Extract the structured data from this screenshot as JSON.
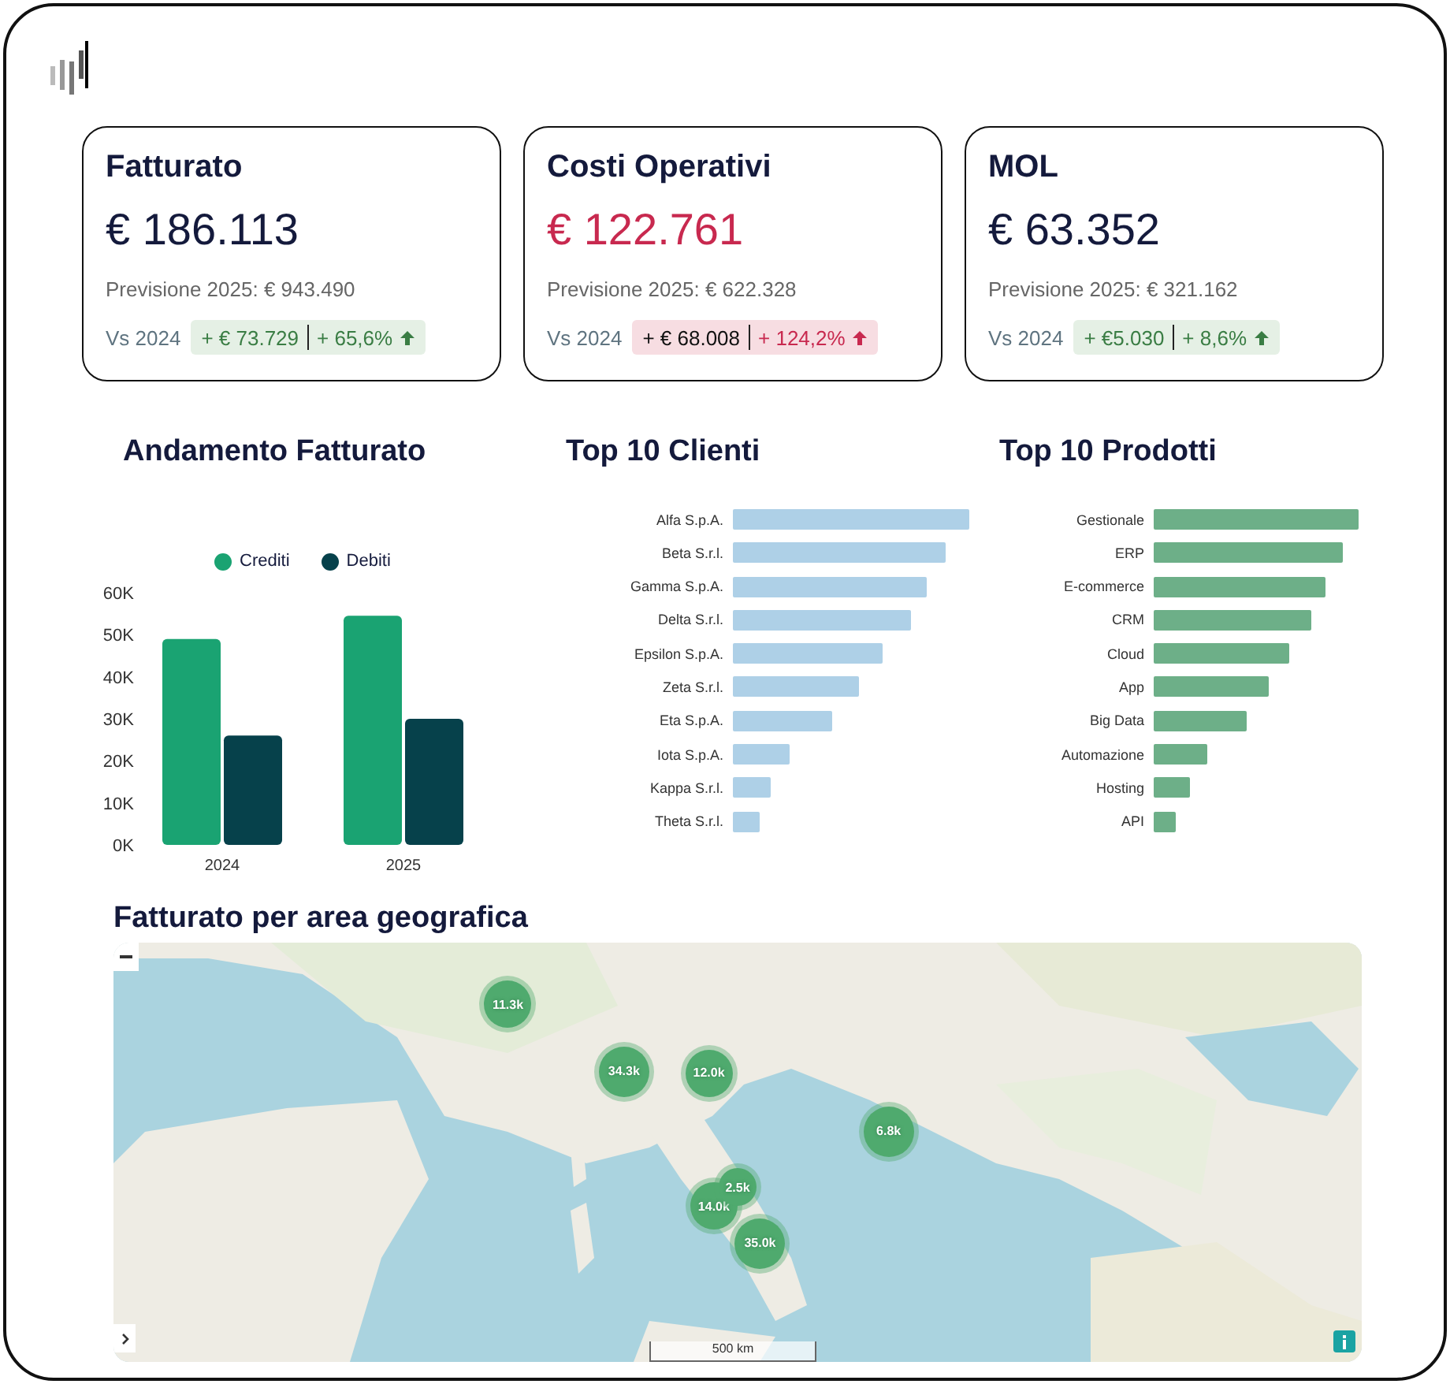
{
  "kpis": [
    {
      "title": "Fatturato",
      "value": "€ 186.113",
      "unfavorable": false,
      "forecast": "Previsione 2025: € 943.490",
      "compare_label": "Vs 2024",
      "delta_abs": "+ € 73.729",
      "delta_pct": "+ 65,6%"
    },
    {
      "title": "Costi Operativi",
      "value": "€ 122.761",
      "unfavorable": true,
      "forecast": "Previsione 2025: € 622.328",
      "compare_label": "Vs 2024",
      "delta_abs": "+ € 68.008",
      "delta_pct": "+ 124,2%"
    },
    {
      "title": "MOL",
      "value": "€ 63.352",
      "unfavorable": false,
      "forecast": "Previsione 2025: € 321.162",
      "compare_label": "Vs 2024",
      "delta_abs": "+ €5.030",
      "delta_pct": "+ 8,6%"
    }
  ],
  "trend_chart": {
    "title": "Andamento Fatturato",
    "chart_data": {
      "type": "bar",
      "categories": [
        "2024",
        "2025"
      ],
      "series": [
        {
          "name": "Crediti",
          "color": "#1aa372",
          "values": [
            49000,
            54500
          ]
        },
        {
          "name": "Debiti",
          "color": "#06414b",
          "values": [
            26000,
            30000
          ]
        }
      ],
      "ylim": [
        0,
        60000
      ],
      "yticks": [
        {
          "value": 0,
          "label": "0K"
        },
        {
          "value": 10000,
          "label": "10K"
        },
        {
          "value": 20000,
          "label": "20K"
        },
        {
          "value": 30000,
          "label": "30K"
        },
        {
          "value": 40000,
          "label": "40K"
        },
        {
          "value": 50000,
          "label": "50K"
        },
        {
          "value": 60000,
          "label": "60K"
        }
      ]
    }
  },
  "top_clients": {
    "title": "Top 10 Clienti",
    "labels": [
      "Alfa S.p.A.",
      "Beta S.r.l.",
      "Gamma S.p.A.",
      "Delta S.r.l.",
      "Epsilon S.p.A.",
      "Zeta S.r.l.",
      "Eta S.p.A.",
      "Iota S.p.A.",
      "Kappa S.r.l.",
      "Theta S.r.l."
    ]
  },
  "top_products": {
    "title": "Top 10 Prodotti",
    "labels": [
      "Gestionale",
      "ERP",
      "E-commerce",
      "CRM",
      "Cloud",
      "App",
      "Big Data",
      "Automazione",
      "Hosting",
      "API"
    ]
  },
  "map": {
    "title": "Fatturato per area geografica",
    "scale": "500 km",
    "markers": [
      {
        "label": "11.3k"
      },
      {
        "label": "34.3k"
      },
      {
        "label": "12.0k"
      },
      {
        "label": "6.8k"
      },
      {
        "label": "2.5k"
      },
      {
        "label": "14.0k"
      },
      {
        "label": "35.0k"
      }
    ]
  }
}
